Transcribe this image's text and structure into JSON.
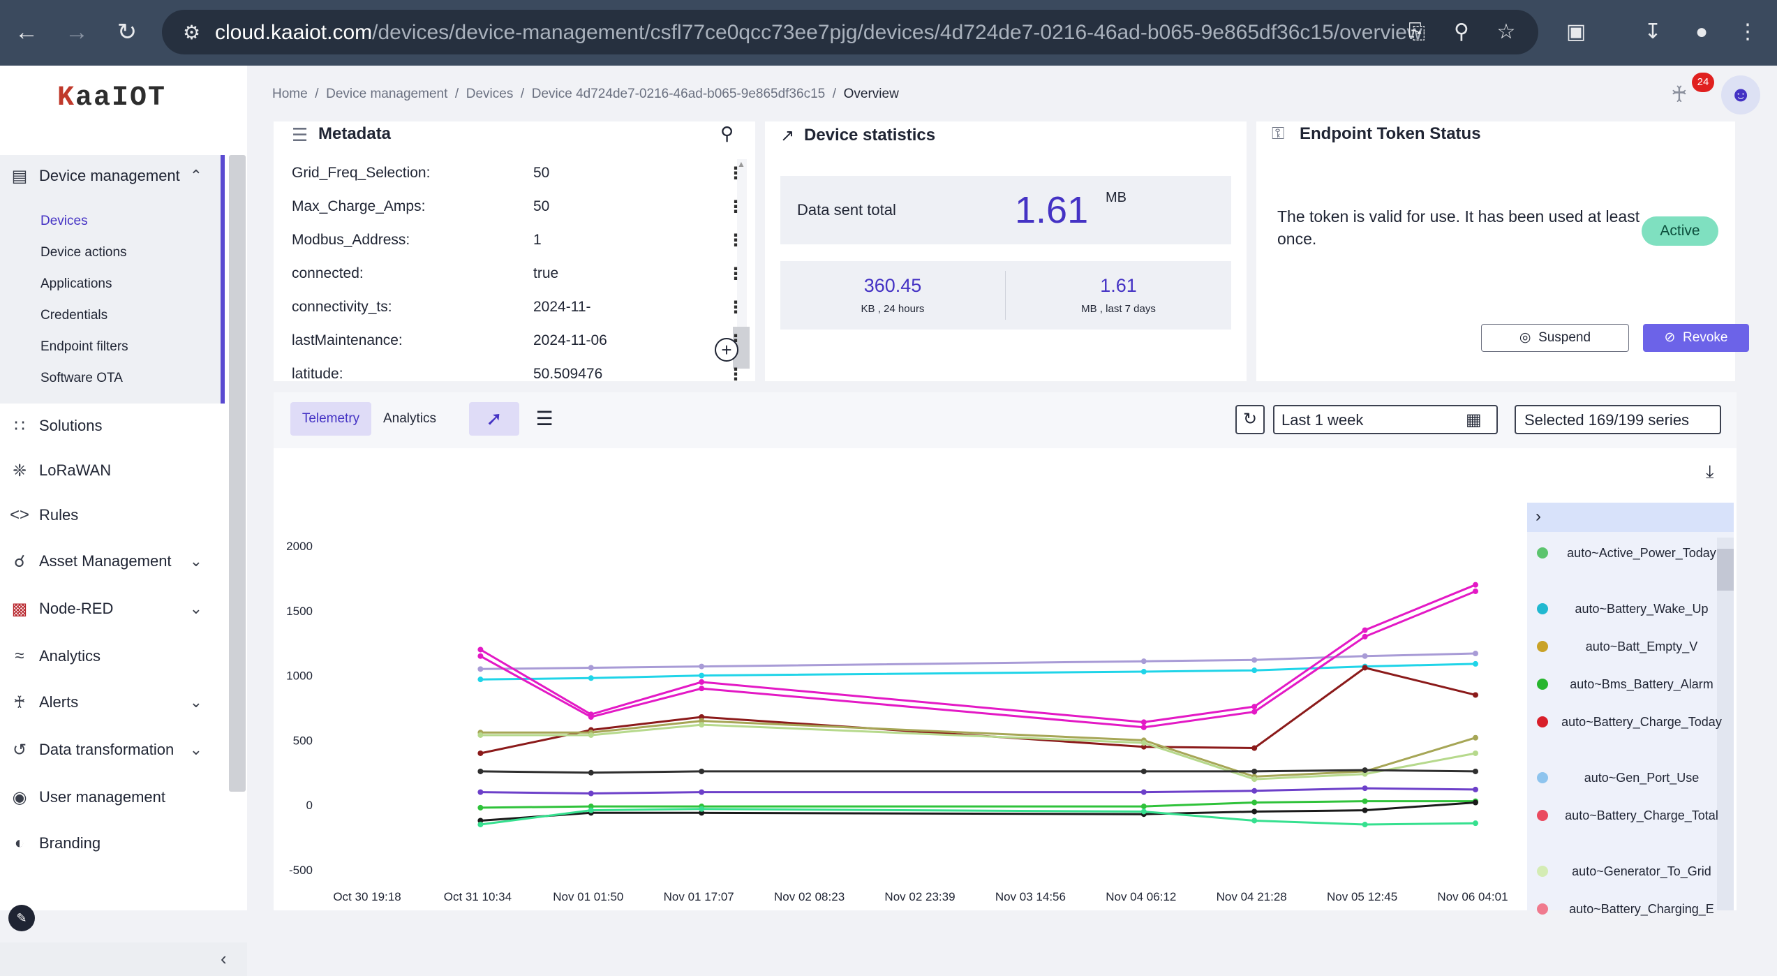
{
  "browser": {
    "url_host": "cloud.kaaiot.com",
    "url_path": "/devices/device-management/csfl77ce0qcc73ee7pjg/devices/4d724de7-0216-46ad-b065-9e865df36c15/overview"
  },
  "logo": {
    "part1": "K",
    "part2": "aaIOT"
  },
  "sidebar": {
    "device_management": "Device management",
    "sub_items": [
      "Devices",
      "Device actions",
      "Applications",
      "Credentials",
      "Endpoint filters",
      "Software OTA"
    ],
    "items": [
      "Solutions",
      "LoRaWAN",
      "Rules",
      "Asset Management",
      "Node-RED",
      "Analytics",
      "Alerts",
      "Data transformation",
      "User management",
      "Branding"
    ]
  },
  "breadcrumb": {
    "home": "Home",
    "device_management": "Device management",
    "devices": "Devices",
    "device": "Device 4d724de7-0216-46ad-b065-9e865df36c15",
    "current": "Overview"
  },
  "notifications": {
    "count": "24"
  },
  "metadata": {
    "title": "Metadata",
    "rows": [
      {
        "key": "Grid_Freq_Selection:",
        "value": "50"
      },
      {
        "key": "Max_Charge_Amps:",
        "value": "50"
      },
      {
        "key": "Modbus_Address:",
        "value": "1"
      },
      {
        "key": "connected:",
        "value": "true"
      },
      {
        "key": "connectivity_ts:",
        "value": "2024-11-"
      },
      {
        "key": "lastMaintenance:",
        "value": "2024-11-06"
      },
      {
        "key": "latitude:",
        "value": "50.509476"
      }
    ]
  },
  "stats": {
    "title": "Device statistics",
    "total_label": "Data sent total",
    "total_value": "1.61",
    "total_unit": "MB",
    "day_value": "360.45",
    "day_label": "KB , 24 hours",
    "week_value": "1.61",
    "week_label": "MB , last 7 days"
  },
  "token": {
    "title": "Endpoint Token Status",
    "text": "The token is valid for use. It has been used at least once.",
    "status": "Active",
    "suspend": "Suspend",
    "revoke": "Revoke"
  },
  "telemetry": {
    "tab_telemetry": "Telemetry",
    "tab_analytics": "Analytics",
    "period": "Last 1 week",
    "series_selected": "Selected 169/199 series"
  },
  "legend": [
    {
      "label": "auto~Active_Power_Today",
      "color": "#5cc46e"
    },
    {
      "label": "auto~Battery_Wake_Up",
      "color": "#20b8d0"
    },
    {
      "label": "auto~Batt_Empty_V",
      "color": "#c9a227"
    },
    {
      "label": "auto~Bms_Battery_Alarm",
      "color": "#27b52e"
    },
    {
      "label": "auto~Battery_Charge_Today",
      "color": "#d81f2a"
    },
    {
      "label": "auto~Gen_Port_Use",
      "color": "#8ec4ee"
    },
    {
      "label": "auto~Battery_Charge_Total",
      "color": "#ea4a5f"
    },
    {
      "label": "auto~Generator_To_Grid",
      "color": "#d4ecb4"
    },
    {
      "label": "auto~Battery_Charging_E",
      "color": "#f07a8e"
    }
  ],
  "chart_data": {
    "type": "line",
    "x": [
      "Oct 30 19:18",
      "Oct 31 10:34",
      "Nov 01 01:50",
      "Nov 01 17:07",
      "Nov 02 08:23",
      "Nov 02 23:39",
      "Nov 03 14:56",
      "Nov 04 06:12",
      "Nov 04 21:28",
      "Nov 05 12:45",
      "Nov 06 04:01"
    ],
    "yticks": [
      "2000",
      "1500",
      "1000",
      "500",
      "0",
      "-500"
    ],
    "ylim": [
      -500,
      2000
    ],
    "series": [
      {
        "color": "#a89bd6",
        "values": [
          null,
          1050,
          1060,
          1070,
          null,
          null,
          null,
          1110,
          1120,
          1150,
          1170
        ]
      },
      {
        "color": "#1fd4e8",
        "values": [
          null,
          970,
          980,
          1000,
          null,
          null,
          null,
          1030,
          1040,
          1070,
          1090
        ]
      },
      {
        "color": "#e319c5",
        "values": [
          null,
          1200,
          700,
          950,
          null,
          null,
          null,
          640,
          760,
          1350,
          1700
        ]
      },
      {
        "color": "#e319c5",
        "values": [
          null,
          1150,
          680,
          900,
          null,
          null,
          null,
          600,
          720,
          1300,
          1650
        ]
      },
      {
        "color": "#8b1a1a",
        "values": [
          null,
          400,
          580,
          680,
          null,
          null,
          null,
          450,
          440,
          1060,
          850
        ]
      },
      {
        "color": "#a6a656",
        "values": [
          null,
          560,
          560,
          650,
          null,
          null,
          null,
          500,
          220,
          260,
          520
        ]
      },
      {
        "color": "#b6d98c",
        "values": [
          null,
          540,
          540,
          620,
          null,
          null,
          null,
          480,
          200,
          240,
          400
        ]
      },
      {
        "color": "#2e2e2e",
        "values": [
          null,
          260,
          250,
          260,
          null,
          null,
          null,
          260,
          260,
          270,
          260
        ]
      },
      {
        "color": "#6c3fc9",
        "values": [
          null,
          100,
          90,
          100,
          null,
          null,
          null,
          100,
          110,
          130,
          120
        ]
      },
      {
        "color": "#2fc23a",
        "values": [
          null,
          -20,
          -10,
          -10,
          null,
          null,
          null,
          -10,
          20,
          30,
          30
        ]
      },
      {
        "color": "#1a1a1a",
        "values": [
          null,
          -120,
          -60,
          -60,
          null,
          null,
          null,
          -70,
          -50,
          -40,
          20
        ]
      },
      {
        "color": "#36e08f",
        "values": [
          null,
          -150,
          -40,
          -30,
          null,
          null,
          null,
          -50,
          -120,
          -150,
          -140
        ]
      }
    ]
  }
}
